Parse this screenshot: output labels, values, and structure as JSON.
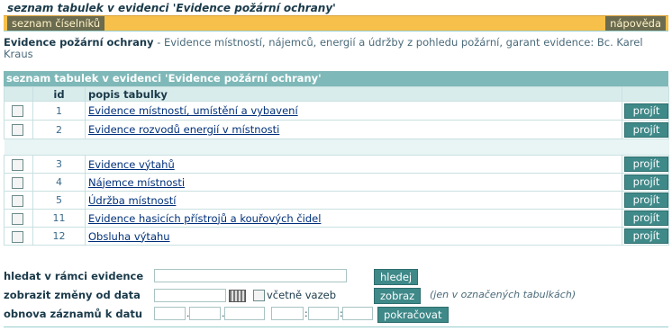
{
  "page": {
    "title": "seznam tabulek v evidenci 'Evidence požární ochrany'"
  },
  "topbar": {
    "left_button": "seznam číselníků",
    "right_button": "nápověda"
  },
  "description": {
    "name": "Evidence požární ochrany",
    "text": " - Evidence místností, nájemců, energií a údržby z pohledu požární, garant evidence: Bc. Karel Kraus"
  },
  "table": {
    "header": "seznam tabulek v evidenci 'Evidence požární ochrany'",
    "col_id": "id",
    "col_desc": "popis tabulky",
    "go_label": "projít",
    "group1": [
      {
        "id": "1",
        "desc": "Evidence místností, umístění a vybavení"
      },
      {
        "id": "2",
        "desc": "Evidence rozvodů energií v místnosti"
      }
    ],
    "group2": [
      {
        "id": "3",
        "desc": "Evidence výtahů"
      },
      {
        "id": "4",
        "desc": "Nájemce místnosti"
      },
      {
        "id": "5",
        "desc": "Údržba místností"
      },
      {
        "id": "11",
        "desc": "Evidence hasicích přístrojů a kouřových čidel"
      },
      {
        "id": "12",
        "desc": "Obsluha výtahu"
      }
    ]
  },
  "search": {
    "label": "hledat v rámci evidence",
    "button": "hledej",
    "value": ""
  },
  "changes": {
    "label": "zobrazit změny od data",
    "checkbox_label": "včetně vazeb",
    "button": "zobraz",
    "note": "(jen v označených tabulkách)"
  },
  "restore": {
    "label": "obnova záznamů k datu",
    "date_sep": ".",
    "time_sep": ":",
    "button": "pokračovat"
  },
  "colors": {
    "topbar": "#f7c04a",
    "header": "#7fb8b8",
    "button": "#3f8989",
    "link": "#00307a"
  }
}
